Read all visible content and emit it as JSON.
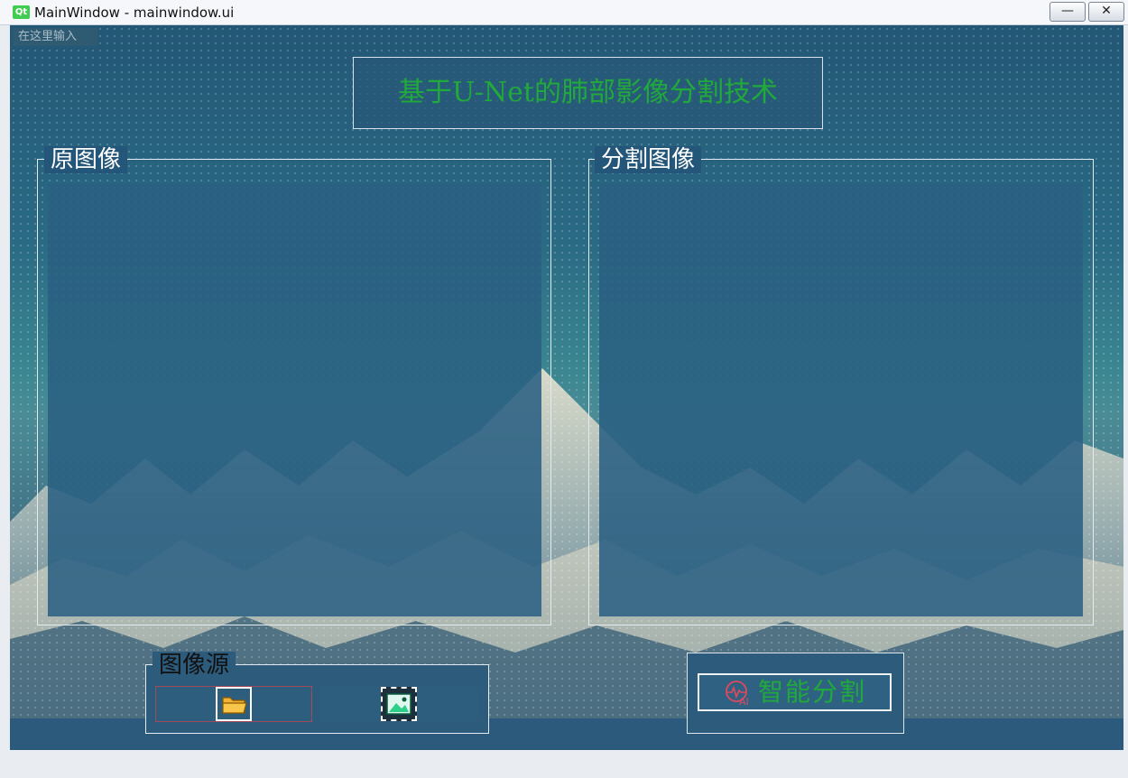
{
  "window": {
    "logo": "Qt",
    "title": "MainWindow - mainwindow.ui",
    "min_glyph": "—",
    "close_glyph": "✕"
  },
  "menubar": {
    "placeholder": "在这里输入"
  },
  "header": {
    "title": "基于U-Net的肺部影像分割技术"
  },
  "panels": {
    "original": {
      "title": "原图像"
    },
    "segmented": {
      "title": "分割图像"
    }
  },
  "source": {
    "title": "图像源",
    "open_icon": "folder-icon",
    "image_icon": "image-icon"
  },
  "actions": {
    "segment_label": "智能分割",
    "segment_icon": "ai-pulse-icon"
  },
  "colors": {
    "accent_green": "#21a93b",
    "panel_blue": "#2a6082",
    "border": "#e4ebf1"
  }
}
